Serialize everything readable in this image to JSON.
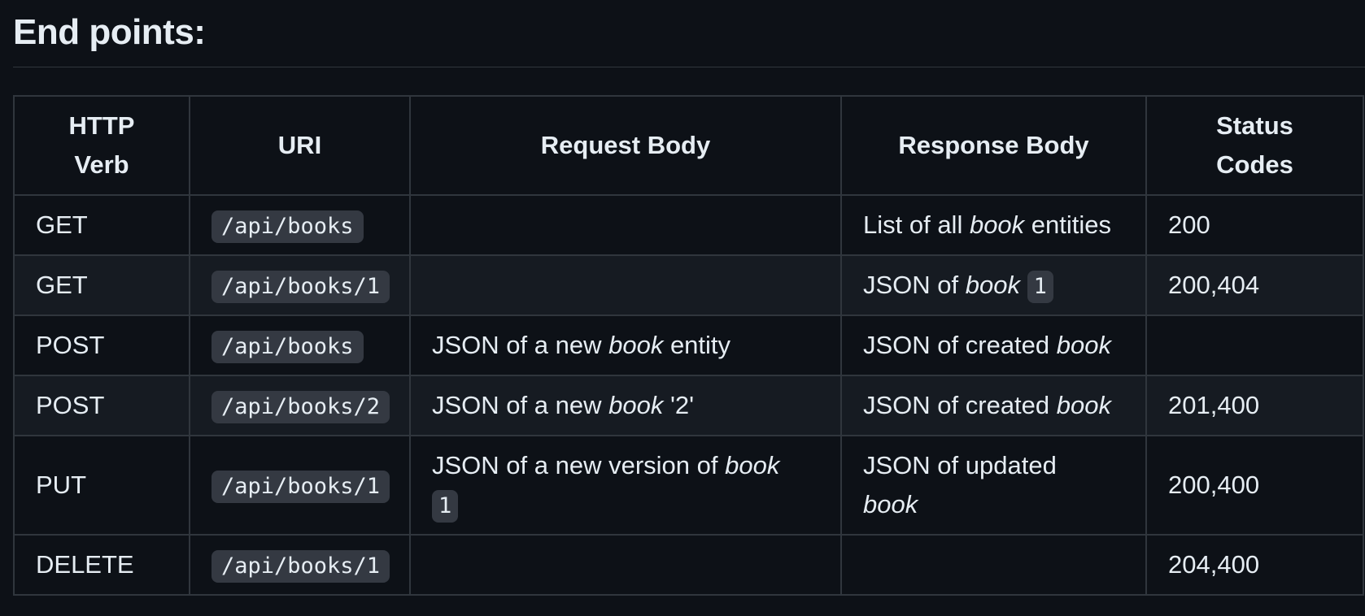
{
  "heading": "End points:",
  "table": {
    "headers": {
      "verb": "HTTP Verb",
      "uri": "URI",
      "request": "Request Body",
      "response": "Response Body",
      "status": "Status Codes"
    },
    "rows": [
      {
        "verb": "GET",
        "uri": "/api/books",
        "request": {
          "pre": "",
          "em": "",
          "post": "",
          "code": ""
        },
        "response": {
          "pre": "List of all ",
          "em": "book",
          "post": " entities",
          "code": ""
        },
        "status": "200"
      },
      {
        "verb": "GET",
        "uri": "/api/books/1",
        "request": {
          "pre": "",
          "em": "",
          "post": "",
          "code": ""
        },
        "response": {
          "pre": "JSON of ",
          "em": "book",
          "post": " ",
          "code": "1"
        },
        "status": "200,404"
      },
      {
        "verb": "POST",
        "uri": "/api/books",
        "request": {
          "pre": "JSON of a new ",
          "em": "book",
          "post": " entity",
          "code": ""
        },
        "response": {
          "pre": "JSON of created ",
          "em": "book",
          "post": "",
          "code": ""
        },
        "status": ""
      },
      {
        "verb": "POST",
        "uri": "/api/books/2",
        "request": {
          "pre": "JSON of a new ",
          "em": "book",
          "post": " '2'",
          "code": ""
        },
        "response": {
          "pre": "JSON of created ",
          "em": "book",
          "post": "",
          "code": ""
        },
        "status": "201,400"
      },
      {
        "verb": "PUT",
        "uri": "/api/books/1",
        "request": {
          "pre": "JSON of a new version of ",
          "em": "book",
          "post": " ",
          "code": "1"
        },
        "response": {
          "pre": "JSON of updated ",
          "em": "book",
          "post": "",
          "code": ""
        },
        "status": "200,400"
      },
      {
        "verb": "DELETE",
        "uri": "/api/books/1",
        "request": {
          "pre": "",
          "em": "",
          "post": "",
          "code": ""
        },
        "response": {
          "pre": "",
          "em": "",
          "post": "",
          "code": ""
        },
        "status": "204,400"
      }
    ]
  }
}
